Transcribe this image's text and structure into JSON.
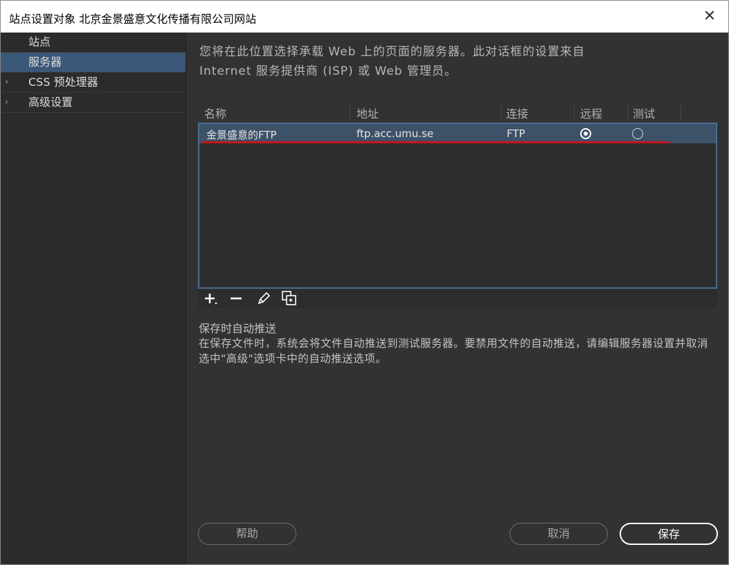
{
  "window": {
    "title": "站点设置对象 北京金景盛意文化传播有限公司网站",
    "close_glyph": "✕"
  },
  "sidebar": {
    "items": [
      {
        "label": "站点",
        "chevron": ""
      },
      {
        "label": "服务器",
        "chevron": ""
      },
      {
        "label": "CSS 预处理器",
        "chevron": "›"
      },
      {
        "label": "高级设置",
        "chevron": "›"
      }
    ]
  },
  "main": {
    "intro_line1": "您将在此位置选择承载 Web 上的页面的服务器。此对话框的设置来自",
    "intro_line2": "Internet 服务提供商 (ISP) 或 Web 管理员。",
    "table": {
      "columns": [
        "名称",
        "地址",
        "连接",
        "远程",
        "测试"
      ],
      "rows": [
        {
          "name": "金景盛意的FTP",
          "address": "ftp.acc.umu.se",
          "connection": "FTP",
          "remote": true,
          "test": false
        }
      ]
    },
    "toolbar_icons": [
      "plus-icon",
      "minus-icon",
      "pencil-icon",
      "duplicate-icon"
    ],
    "autopush_title": "保存时自动推送",
    "autopush_body": "在保存文件时，系统会将文件自动推送到测试服务器。要禁用文件的自动推送，请编辑服务器设置并取消选中\"高级\"选项卡中的自动推送选项。"
  },
  "buttons": {
    "help": "帮助",
    "cancel": "取消",
    "save": "保存"
  },
  "colors": {
    "selection": "#3b5878",
    "row_selected": "#3d5168",
    "underline_mark": "#c8161d"
  }
}
